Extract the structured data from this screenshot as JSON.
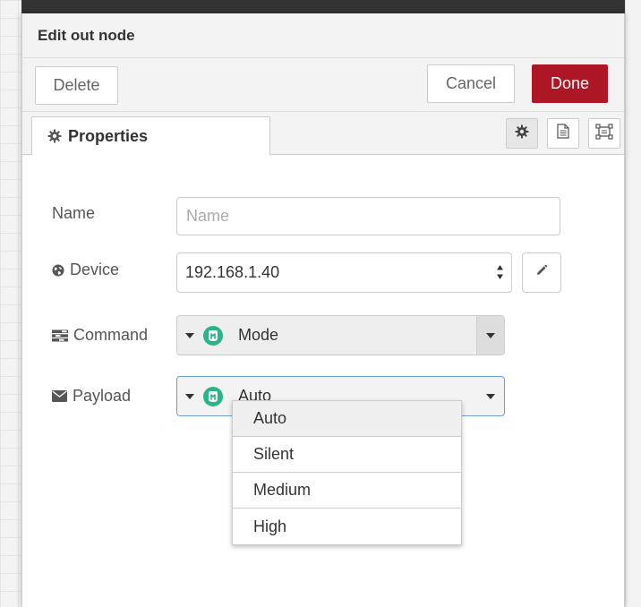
{
  "tray": {
    "title": "Edit out node",
    "delete_label": "Delete",
    "cancel_label": "Cancel",
    "done_label": "Done"
  },
  "tabs": {
    "properties_label": "Properties"
  },
  "form": {
    "name": {
      "label": "Name",
      "placeholder": "Name",
      "value": ""
    },
    "device": {
      "label": "Device",
      "value": "192.168.1.40"
    },
    "command": {
      "label": "Command",
      "value": "Mode"
    },
    "payload": {
      "label": "Payload",
      "value": "Auto"
    }
  },
  "payload_options": [
    "Auto",
    "Silent",
    "Medium",
    "High"
  ],
  "colors": {
    "done": "#ad1625",
    "logo": "#2bb38a"
  },
  "icons": {
    "tab": "gear-icon",
    "device": "globe-icon",
    "command": "tasks-icon",
    "payload": "envelope-icon"
  }
}
